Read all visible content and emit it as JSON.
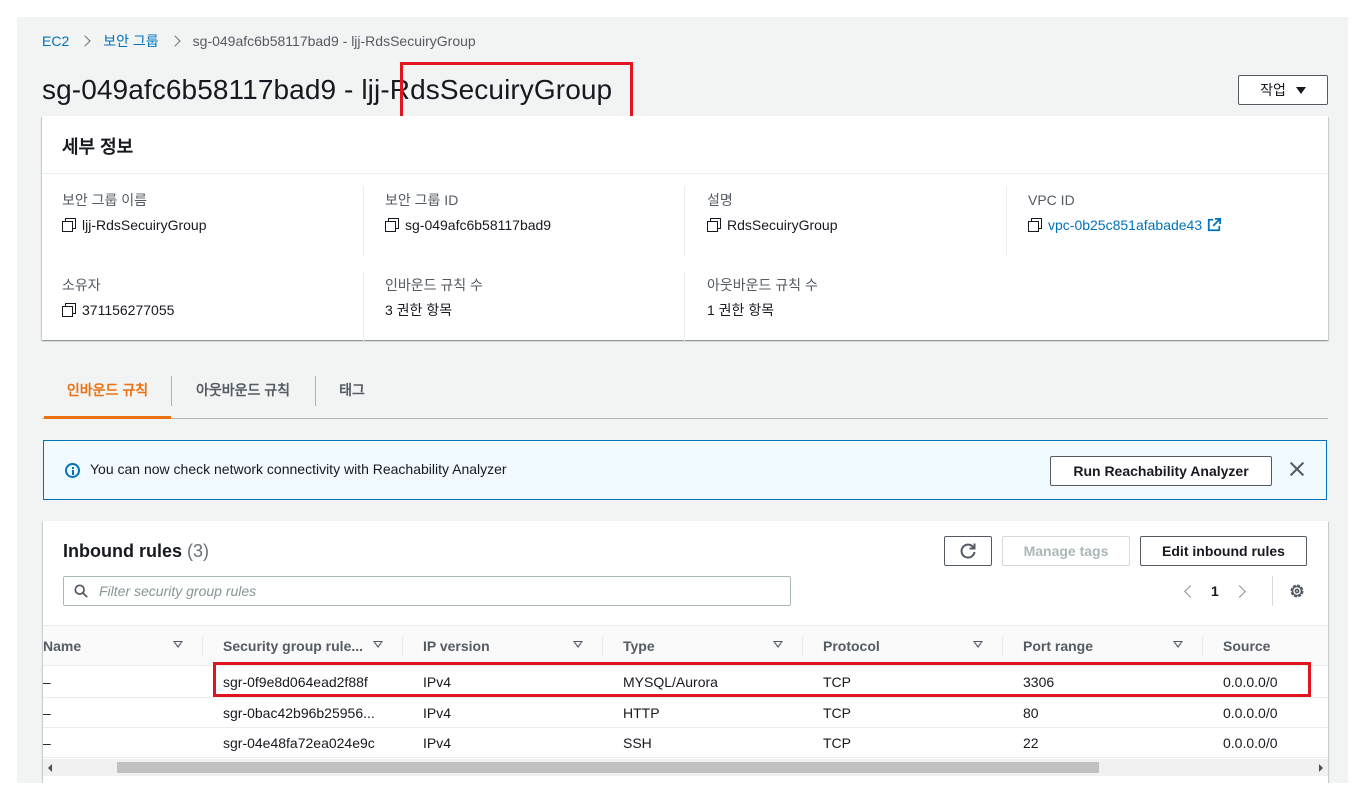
{
  "breadcrumb": {
    "items": [
      "EC2",
      "보안 그룹"
    ],
    "current": "sg-049afc6b58117bad9 - ljj-RdsSecuiryGroup"
  },
  "page_title": "sg-049afc6b58117bad9 - ljj-RdsSecuiryGroup",
  "actions_label": "작업",
  "details": {
    "heading": "세부 정보",
    "fields": [
      {
        "label": "보안 그룹 이름",
        "value": "ljj-RdsSecuiryGroup"
      },
      {
        "label": "보안 그룹 ID",
        "value": "sg-049afc6b58117bad9"
      },
      {
        "label": "설명",
        "value": "RdsSecuiryGroup"
      },
      {
        "label": "VPC ID",
        "value": "vpc-0b25c851afabade43"
      },
      {
        "label": "소유자",
        "value": "371156277055"
      },
      {
        "label": "인바운드 규칙 수",
        "value": "3 권한 항목"
      },
      {
        "label": "아웃바운드 규칙 수",
        "value": "1 권한 항목"
      }
    ]
  },
  "tabs": [
    "인바운드 규칙",
    "아웃바운드 규칙",
    "태그"
  ],
  "banner": {
    "message": "You can now check network connectivity with Reachability Analyzer",
    "button": "Run Reachability Analyzer"
  },
  "inbound": {
    "title": "Inbound rules",
    "count": "(3)",
    "manage_tags": "Manage tags",
    "edit_rules": "Edit inbound rules",
    "filter_placeholder": "Filter security group rules",
    "page": "1",
    "columns": [
      "Name",
      "Security group rule...",
      "IP version",
      "Type",
      "Protocol",
      "Port range",
      "Source"
    ],
    "rows": [
      [
        "–",
        "sgr-0f9e8d064ead2f88f",
        "IPv4",
        "MYSQL/Aurora",
        "TCP",
        "3306",
        "0.0.0.0/0"
      ],
      [
        "–",
        "sgr-0bac42b96b25956...",
        "IPv4",
        "HTTP",
        "TCP",
        "80",
        "0.0.0.0/0"
      ],
      [
        "–",
        "sgr-04e48fa72ea024e9c",
        "IPv4",
        "SSH",
        "TCP",
        "22",
        "0.0.0.0/0"
      ]
    ]
  },
  "colors": {
    "link": "#0073bb",
    "active_tab": "#ec7211",
    "highlight": "#e0151d"
  }
}
